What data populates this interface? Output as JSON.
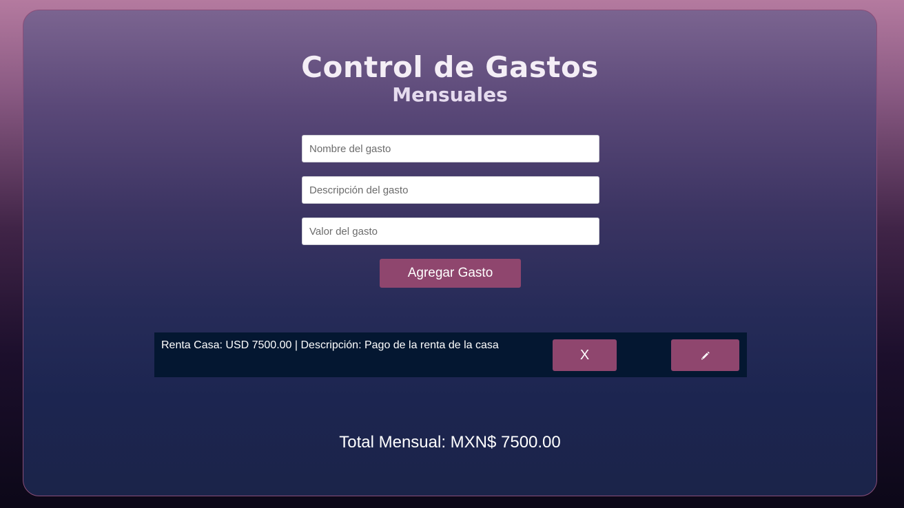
{
  "header": {
    "title": "Control de Gastos",
    "subtitle": "Mensuales"
  },
  "form": {
    "name_placeholder": "Nombre del gasto",
    "description_placeholder": "Descripción del gasto",
    "value_placeholder": "Valor del gasto",
    "name_value": "",
    "description_value": "",
    "value_value": "",
    "add_button_label": "Agregar Gasto"
  },
  "expenses": [
    {
      "text": "Renta Casa: USD 7500.00 | Descripción: Pago de la renta de la casa",
      "delete_label": "X",
      "edit_icon": "pencil-icon"
    }
  ],
  "summary": {
    "total_text": "Total Mensual: MXN$ 7500.00"
  },
  "colors": {
    "accent": "#8f466e",
    "row_background": "#041731"
  }
}
